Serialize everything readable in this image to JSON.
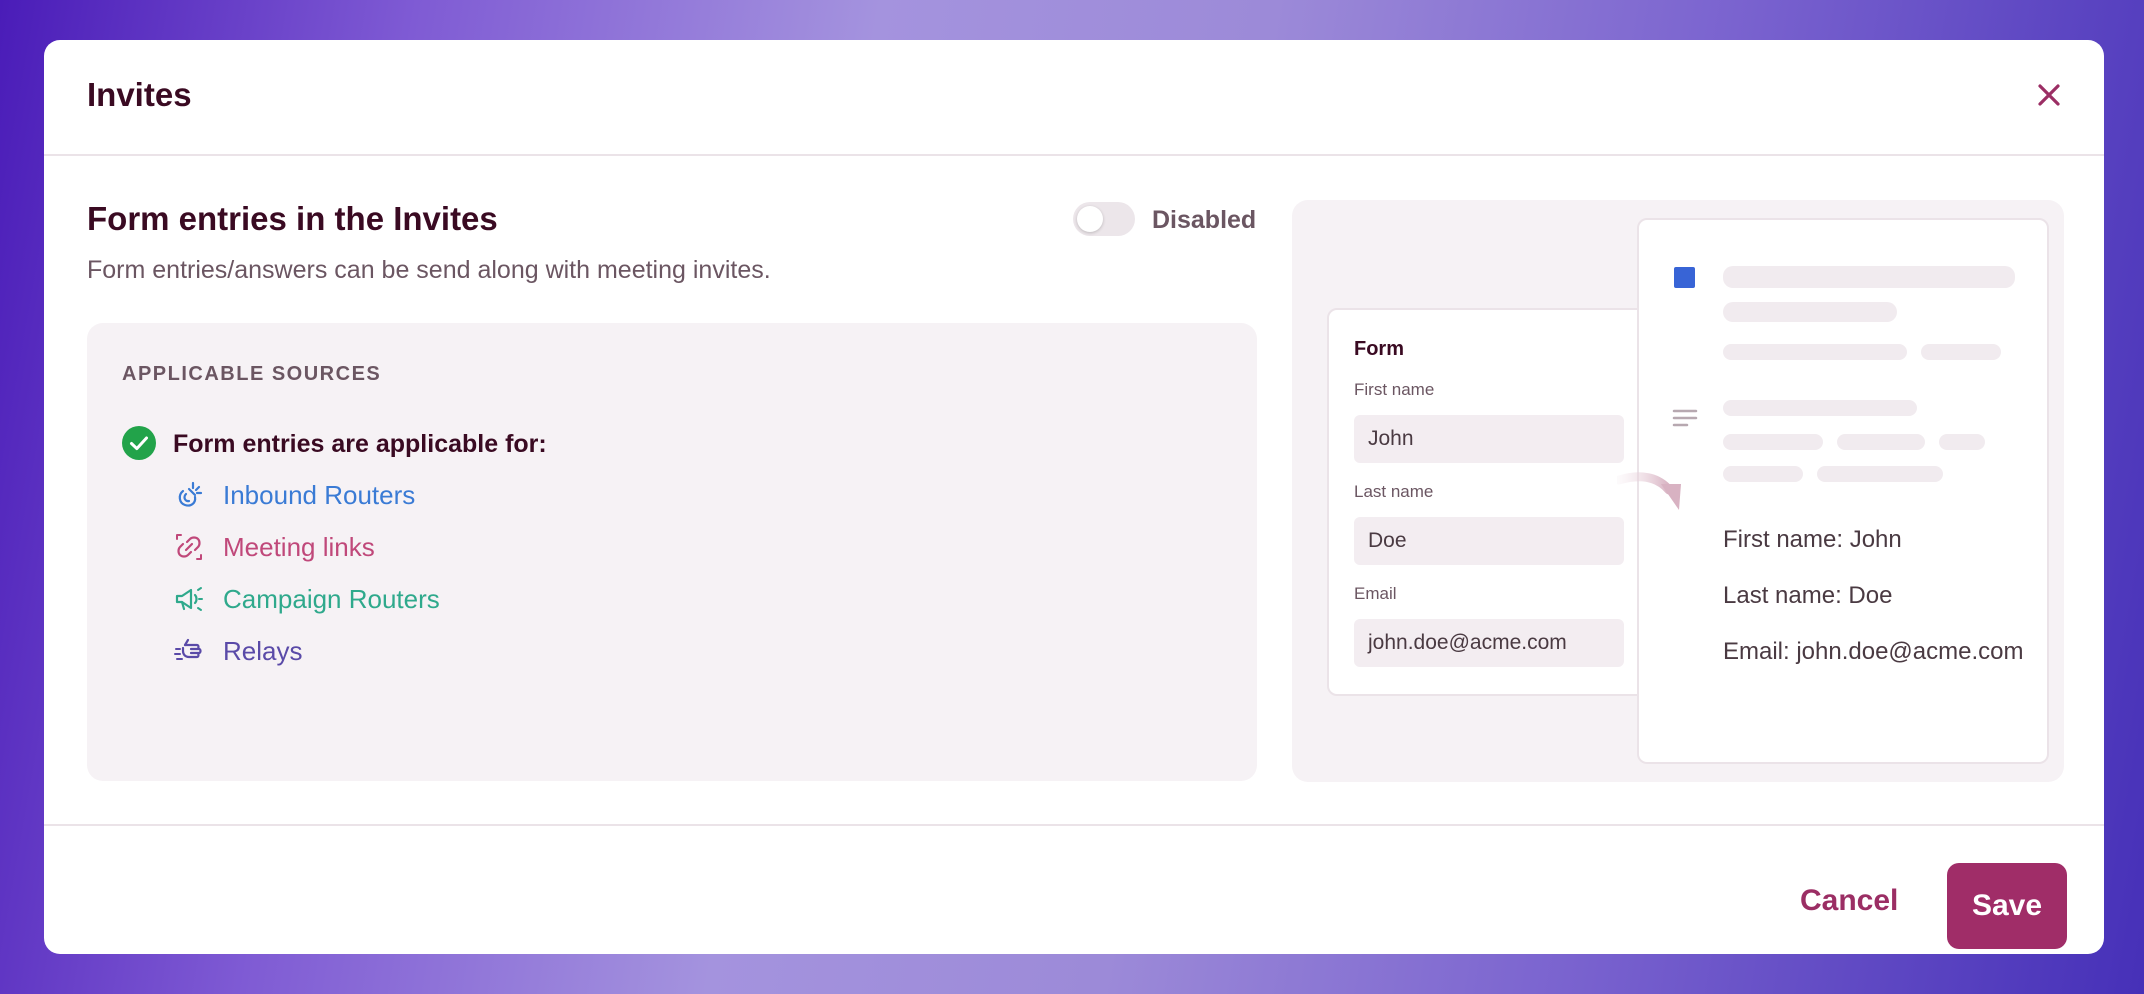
{
  "modal": {
    "title": "Invites"
  },
  "section": {
    "title": "Form entries in the Invites",
    "description": "Form entries/answers can be send along with meeting invites.",
    "toggle_label": "Disabled",
    "toggle_state": "off"
  },
  "sources": {
    "heading": "APPLICABLE SOURCES",
    "applicable_label": "Form entries are applicable for:",
    "items": [
      {
        "label": "Inbound Routers",
        "icon": "inbound-router-icon",
        "color": "#3a7bd5"
      },
      {
        "label": "Meeting links",
        "icon": "meeting-link-icon",
        "color": "#c0487a"
      },
      {
        "label": "Campaign Routers",
        "icon": "campaign-router-icon",
        "color": "#2fa98c"
      },
      {
        "label": "Relays",
        "icon": "relay-icon",
        "color": "#5a4aa8"
      }
    ]
  },
  "preview": {
    "form_title": "Form",
    "fields": [
      {
        "label": "First name",
        "value": "John"
      },
      {
        "label": "Last name",
        "value": "Doe"
      },
      {
        "label": "Email",
        "value": "john.doe@acme.com"
      }
    ],
    "result_lines": [
      "First name:  John",
      "Last name: Doe",
      "Email: john.doe@acme.com"
    ]
  },
  "footer": {
    "cancel_label": "Cancel",
    "save_label": "Save"
  },
  "colors": {
    "accent": "#a02d68",
    "success": "#22a34a",
    "preview_square": "#3864d6"
  }
}
